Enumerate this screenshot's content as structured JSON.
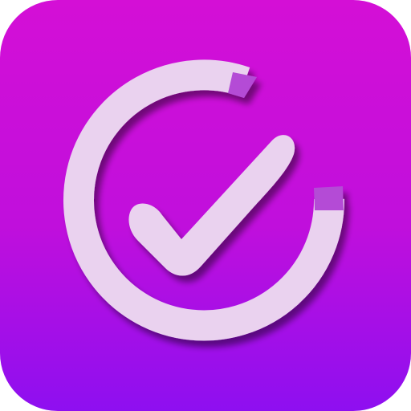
{
  "app_icon": {
    "name": "checkmark-app-icon",
    "glyph": "check-circle-icon",
    "colors": {
      "gradient_top": "#d40fd6",
      "gradient_mid": "#c00fdc",
      "gradient_bottom": "#8e0ff0",
      "glyph_fill": "#ead2ef",
      "glyph_highlight": "#f6e8f8",
      "ring_tip": "#b44bd6",
      "shadow": "#5a0a7a"
    }
  }
}
